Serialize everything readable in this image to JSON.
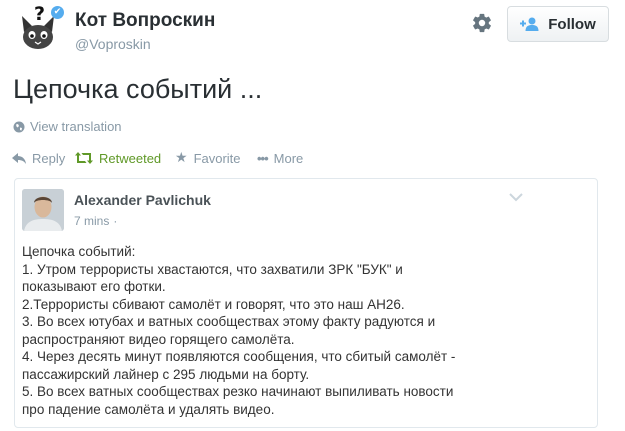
{
  "profile": {
    "display_name": "Кот Вопроскин",
    "handle": "@Voproskin",
    "avatar_icon": "cat-question-icon",
    "verified_icon": "verified-badge-icon"
  },
  "header": {
    "settings_icon": "gear-icon",
    "follow_label": "Follow",
    "follow_icon": "add-person-icon"
  },
  "tweet": {
    "text": "Цепочка событий ...",
    "translate_label": "View translation"
  },
  "actions": {
    "reply": "Reply",
    "retweet": "Retweeted",
    "favorite": "Favorite",
    "more": "More",
    "retweet_color": "#609928"
  },
  "quoted": {
    "author": "Alexander Pavlichuk",
    "time": "7 mins",
    "separator": "·",
    "lines": [
      "Цепочка событий:",
      "1. Утром террористы хвастаются, что захватили ЗРК \"БУК\" и",
      "показывают его фотки.",
      "2.Террористы сбивают самолёт и говорят, что это наш АН26.",
      "3. Во всех ютубах и ватных сообществах этому факту радуются и",
      "распространяют видео горящего самолёта.",
      "4. Через десять минут появляются сообщения, что сбитый самолёт -",
      "пассажирский лайнер с 295 людьми на борту.",
      "5. Во всех ватных сообществах резко начинают выпиливать новости",
      "про падение самолёта и удалять видео."
    ]
  }
}
